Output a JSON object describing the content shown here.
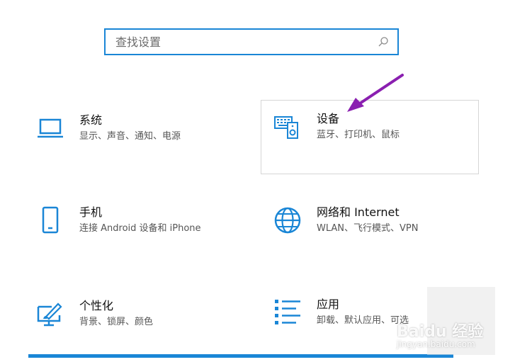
{
  "search": {
    "placeholder": "查找设置"
  },
  "tiles": [
    {
      "title": "系统",
      "subtitle": "显示、声音、通知、电源",
      "icon": "laptop-icon"
    },
    {
      "title": "设备",
      "subtitle": "蓝牙、打印机、鼠标",
      "icon": "devices-icon"
    },
    {
      "title": "手机",
      "subtitle": "连接 Android 设备和 iPhone",
      "icon": "phone-icon"
    },
    {
      "title": "网络和 Internet",
      "subtitle": "WLAN、飞行模式、VPN",
      "icon": "globe-icon"
    },
    {
      "title": "个性化",
      "subtitle": "背景、锁屏、颜色",
      "icon": "personalize-icon"
    },
    {
      "title": "应用",
      "subtitle": "卸载、默认应用、可选",
      "icon": "apps-icon"
    }
  ],
  "watermark": {
    "brand": "Baidu 经验",
    "url": "jingyan.baidu.com"
  },
  "colors": {
    "accent": "#1a86d6",
    "arrow": "#8a1fb0"
  }
}
